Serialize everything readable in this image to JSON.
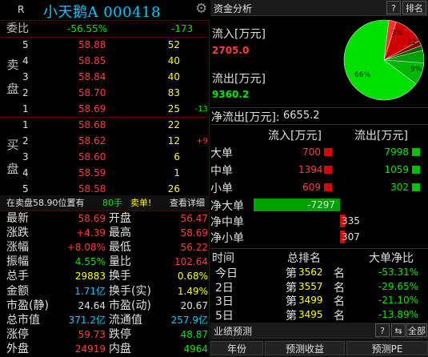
{
  "header": {
    "market_letter": "R",
    "stock_title": "小天鹅A 000418",
    "settings_icon": "gear-icon"
  },
  "commission": {
    "label": "委比",
    "ratio": "-56.55%",
    "diff": "-173"
  },
  "sell_side_label": [
    "卖",
    "盘"
  ],
  "sell": [
    {
      "level": "5",
      "price": "58.88",
      "volume": "52",
      "change": ""
    },
    {
      "level": "4",
      "price": "58.85",
      "volume": "40",
      "change": ""
    },
    {
      "level": "3",
      "price": "58.84",
      "volume": "40",
      "change": ""
    },
    {
      "level": "2",
      "price": "58.70",
      "volume": "83",
      "change": ""
    },
    {
      "level": "1",
      "price": "58.69",
      "volume": "25",
      "change": "-13"
    }
  ],
  "buy_side_label": [
    "买",
    "盘"
  ],
  "buy": [
    {
      "level": "1",
      "price": "58.68",
      "volume": "22",
      "change": ""
    },
    {
      "level": "2",
      "price": "58.62",
      "volume": "12",
      "change": "+9"
    },
    {
      "level": "3",
      "price": "58.60",
      "volume": "6",
      "change": ""
    },
    {
      "level": "4",
      "price": "58.59",
      "volume": "1",
      "change": ""
    },
    {
      "level": "5",
      "price": "58.58",
      "volume": "26",
      "change": ""
    }
  ],
  "notice": {
    "text": "在卖盘58.90位置有",
    "amount": "80手",
    "type": "卖单!",
    "link": "查看详细"
  },
  "quote_rows": [
    {
      "l1": "最新",
      "v1": "58.69",
      "c1": "red",
      "l2": "开盘",
      "v2": "56.47",
      "c2": "red"
    },
    {
      "l1": "涨跌",
      "v1": "+4.39",
      "c1": "red",
      "l2": "最高",
      "v2": "58.69",
      "c2": "red"
    },
    {
      "l1": "涨幅",
      "v1": "+8.08%",
      "c1": "red",
      "l2": "最低",
      "v2": "56.22",
      "c2": "red"
    },
    {
      "l1": "振幅",
      "v1": "4.55%",
      "c1": "green",
      "l2": "量比",
      "v2": "102.64",
      "c2": "red"
    },
    {
      "l1": "总手",
      "v1": "29883",
      "c1": "yellow",
      "l2": "换手",
      "v2": "0.68%",
      "c2": "yellow"
    },
    {
      "l1": "金额",
      "v1": "1.71亿",
      "c1": "cyan",
      "l2": "换手(实)",
      "v2": "1.49%",
      "c2": "yellow"
    },
    {
      "l1": "市盈(静)",
      "v1": "24.64",
      "c1": "white",
      "l2": "市盈(动)",
      "v2": "20.67",
      "c2": "white"
    },
    {
      "l1": "总市值",
      "v1": "371.2亿",
      "c1": "cyan",
      "l2": "流通值",
      "v2": "257.9亿",
      "c2": "cyan"
    },
    {
      "l1": "涨停",
      "v1": "59.73",
      "c1": "red",
      "l2": "跌停",
      "v2": "48.87",
      "c2": "green"
    },
    {
      "l1": "外盘",
      "v1": "24919",
      "c1": "red",
      "l2": "内盘",
      "v2": "4964",
      "c2": "green"
    }
  ],
  "capital": {
    "title": "资金分析",
    "help_button": "?",
    "rank_button": "排名",
    "inflow_label": "流入[万元]",
    "inflow_value": "2705.0",
    "outflow_label": "流出[万元]",
    "outflow_value": "9360.2",
    "net_label": "净流出[万元]:",
    "net_value": "6655.2",
    "pie_labels": [
      "3%",
      "12%",
      "9%",
      "66%"
    ]
  },
  "chart_data": {
    "type": "pie",
    "slices": [
      {
        "label": "3%",
        "value": 3,
        "color": "#ff3030"
      },
      {
        "label": "12%",
        "value": 12,
        "color": "#d00000"
      },
      {
        "label": "",
        "value": 2,
        "color": "#800000"
      },
      {
        "label": "",
        "value": 2,
        "color": "#006000"
      },
      {
        "label": "",
        "value": 5,
        "color": "#00a000"
      },
      {
        "label": "9%",
        "value": 9,
        "color": "#00b800"
      },
      {
        "label": "66%",
        "value": 66,
        "color": "#00e000"
      }
    ]
  },
  "flow_table": {
    "col_in": "流入[万元]",
    "col_out": "流出[万元]",
    "rows": [
      {
        "label": "大单",
        "in": "700",
        "out": "7998"
      },
      {
        "label": "中单",
        "in": "1394",
        "out": "1059"
      },
      {
        "label": "小单",
        "in": "609",
        "out": "302"
      }
    ]
  },
  "net_rows": [
    {
      "label": "净大单",
      "value": "-7297",
      "dir": "green",
      "bar": 1.0
    },
    {
      "label": "净中单",
      "value": "335",
      "dir": "red",
      "bar": 0.05
    },
    {
      "label": "净小单",
      "value": "307",
      "dir": "red",
      "bar": 0.04
    }
  ],
  "rank_table": {
    "headers": [
      "时间",
      "总排名",
      "大单净比"
    ],
    "rows": [
      {
        "time": "今日",
        "prefix": "第",
        "rank": "3562",
        "suffix": "名",
        "ratio": "-53.31%"
      },
      {
        "time": "2日",
        "prefix": "第",
        "rank": "3557",
        "suffix": "名",
        "ratio": "-29.65%"
      },
      {
        "time": "3日",
        "prefix": "第",
        "rank": "3499",
        "suffix": "名",
        "ratio": "-21.10%"
      },
      {
        "time": "5日",
        "prefix": "第",
        "rank": "3495",
        "suffix": "名",
        "ratio": "-13.89%"
      }
    ]
  },
  "forecast": {
    "title": "业绩预测",
    "help_button": "?",
    "all_button": "全部",
    "headers": [
      "年份",
      "预测收益",
      "预测PE"
    ]
  }
}
